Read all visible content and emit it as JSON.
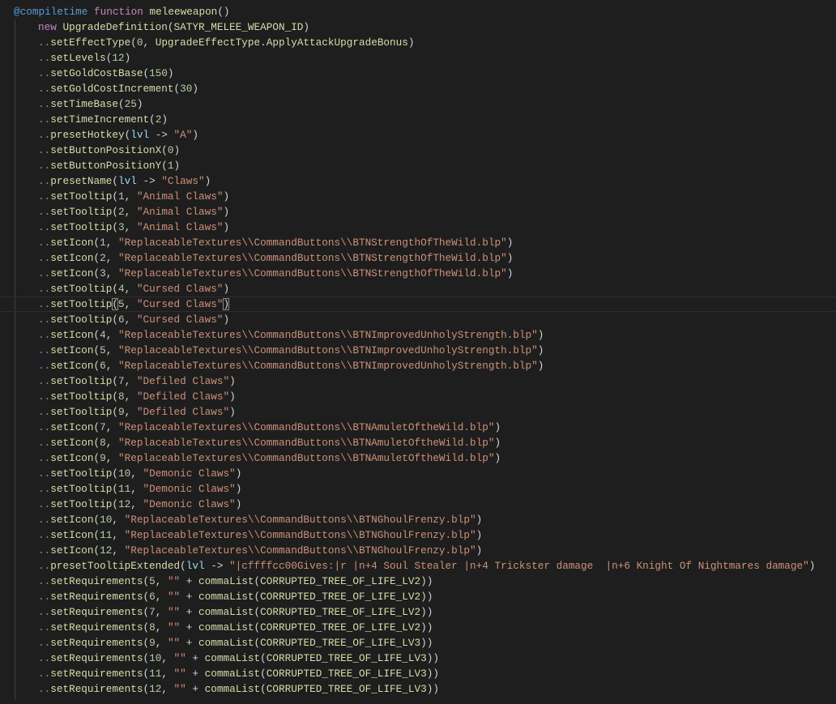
{
  "code": {
    "lines": [
      [
        [
          "k",
          "@compiletime"
        ],
        [
          "p",
          " "
        ],
        [
          "c",
          "function"
        ],
        [
          "p",
          " "
        ],
        [
          "f",
          "meleeweapon"
        ],
        [
          "p",
          "()"
        ]
      ],
      [
        [
          "c",
          "new"
        ],
        [
          "p",
          " "
        ],
        [
          "f",
          "UpgradeDefinition"
        ],
        [
          "p",
          "("
        ],
        [
          "f",
          "SATYR_MELEE_WEAPON_ID"
        ],
        [
          "p",
          ")"
        ]
      ],
      [
        [
          "d",
          ".."
        ],
        [
          "f",
          "setEffectType"
        ],
        [
          "p",
          "("
        ],
        [
          "n",
          "0"
        ],
        [
          "p",
          ", "
        ],
        [
          "f",
          "UpgradeEffectType"
        ],
        [
          "p",
          "."
        ],
        [
          "f",
          "ApplyAttackUpgradeBonus"
        ],
        [
          "p",
          ")"
        ]
      ],
      [
        [
          "d",
          ".."
        ],
        [
          "f",
          "setLevels"
        ],
        [
          "p",
          "("
        ],
        [
          "n",
          "12"
        ],
        [
          "p",
          ")"
        ]
      ],
      [
        [
          "d",
          ".."
        ],
        [
          "f",
          "setGoldCostBase"
        ],
        [
          "p",
          "("
        ],
        [
          "n",
          "150"
        ],
        [
          "p",
          ")"
        ]
      ],
      [
        [
          "d",
          ".."
        ],
        [
          "f",
          "setGoldCostIncrement"
        ],
        [
          "p",
          "("
        ],
        [
          "n",
          "30"
        ],
        [
          "p",
          ")"
        ]
      ],
      [
        [
          "d",
          ".."
        ],
        [
          "f",
          "setTimeBase"
        ],
        [
          "p",
          "("
        ],
        [
          "n",
          "25"
        ],
        [
          "p",
          ")"
        ]
      ],
      [
        [
          "d",
          ".."
        ],
        [
          "f",
          "setTimeIncrement"
        ],
        [
          "p",
          "("
        ],
        [
          "n",
          "2"
        ],
        [
          "p",
          ")"
        ]
      ],
      [
        [
          "d",
          ".."
        ],
        [
          "f",
          "presetHotkey"
        ],
        [
          "p",
          "("
        ],
        [
          "v",
          "lvl"
        ],
        [
          "p",
          " -> "
        ],
        [
          "s",
          "\"A\""
        ],
        [
          "p",
          ")"
        ]
      ],
      [
        [
          "d",
          ".."
        ],
        [
          "f",
          "setButtonPositionX"
        ],
        [
          "p",
          "("
        ],
        [
          "n",
          "0"
        ],
        [
          "p",
          ")"
        ]
      ],
      [
        [
          "d",
          ".."
        ],
        [
          "f",
          "setButtonPositionY"
        ],
        [
          "p",
          "("
        ],
        [
          "n",
          "1"
        ],
        [
          "p",
          ")"
        ]
      ],
      [
        [
          "d",
          ".."
        ],
        [
          "f",
          "presetName"
        ],
        [
          "p",
          "("
        ],
        [
          "v",
          "lvl"
        ],
        [
          "p",
          " -> "
        ],
        [
          "s",
          "\"Claws\""
        ],
        [
          "p",
          ")"
        ]
      ],
      [
        [
          "d",
          ".."
        ],
        [
          "f",
          "setTooltip"
        ],
        [
          "p",
          "("
        ],
        [
          "n",
          "1"
        ],
        [
          "p",
          ", "
        ],
        [
          "s",
          "\"Animal Claws\""
        ],
        [
          "p",
          ")"
        ]
      ],
      [
        [
          "d",
          ".."
        ],
        [
          "f",
          "setTooltip"
        ],
        [
          "p",
          "("
        ],
        [
          "n",
          "2"
        ],
        [
          "p",
          ", "
        ],
        [
          "s",
          "\"Animal Claws\""
        ],
        [
          "p",
          ")"
        ]
      ],
      [
        [
          "d",
          ".."
        ],
        [
          "f",
          "setTooltip"
        ],
        [
          "p",
          "("
        ],
        [
          "n",
          "3"
        ],
        [
          "p",
          ", "
        ],
        [
          "s",
          "\"Animal Claws\""
        ],
        [
          "p",
          ")"
        ]
      ],
      [
        [
          "d",
          ".."
        ],
        [
          "f",
          "setIcon"
        ],
        [
          "p",
          "("
        ],
        [
          "n",
          "1"
        ],
        [
          "p",
          ", "
        ],
        [
          "s",
          "\"ReplaceableTextures\\\\CommandButtons\\\\BTNStrengthOfTheWild.blp\""
        ],
        [
          "p",
          ")"
        ]
      ],
      [
        [
          "d",
          ".."
        ],
        [
          "f",
          "setIcon"
        ],
        [
          "p",
          "("
        ],
        [
          "n",
          "2"
        ],
        [
          "p",
          ", "
        ],
        [
          "s",
          "\"ReplaceableTextures\\\\CommandButtons\\\\BTNStrengthOfTheWild.blp\""
        ],
        [
          "p",
          ")"
        ]
      ],
      [
        [
          "d",
          ".."
        ],
        [
          "f",
          "setIcon"
        ],
        [
          "p",
          "("
        ],
        [
          "n",
          "3"
        ],
        [
          "p",
          ", "
        ],
        [
          "s",
          "\"ReplaceableTextures\\\\CommandButtons\\\\BTNStrengthOfTheWild.blp\""
        ],
        [
          "p",
          ")"
        ]
      ],
      [
        [
          "d",
          ".."
        ],
        [
          "f",
          "setTooltip"
        ],
        [
          "p",
          "("
        ],
        [
          "n",
          "4"
        ],
        [
          "p",
          ", "
        ],
        [
          "s",
          "\"Cursed Claws\""
        ],
        [
          "p",
          ")"
        ]
      ],
      [
        [
          "d",
          ".."
        ],
        [
          "f",
          "setTooltip"
        ],
        [
          "pb",
          "("
        ],
        [
          "n",
          "5"
        ],
        [
          "p",
          ", "
        ],
        [
          "s",
          "\"Cursed Claws\""
        ],
        [
          "pb",
          ")"
        ]
      ],
      [
        [
          "d",
          ".."
        ],
        [
          "f",
          "setTooltip"
        ],
        [
          "p",
          "("
        ],
        [
          "n",
          "6"
        ],
        [
          "p",
          ", "
        ],
        [
          "s",
          "\"Cursed Claws\""
        ],
        [
          "p",
          ")"
        ]
      ],
      [
        [
          "d",
          ".."
        ],
        [
          "f",
          "setIcon"
        ],
        [
          "p",
          "("
        ],
        [
          "n",
          "4"
        ],
        [
          "p",
          ", "
        ],
        [
          "s",
          "\"ReplaceableTextures\\\\CommandButtons\\\\BTNImprovedUnholyStrength.blp\""
        ],
        [
          "p",
          ")"
        ]
      ],
      [
        [
          "d",
          ".."
        ],
        [
          "f",
          "setIcon"
        ],
        [
          "p",
          "("
        ],
        [
          "n",
          "5"
        ],
        [
          "p",
          ", "
        ],
        [
          "s",
          "\"ReplaceableTextures\\\\CommandButtons\\\\BTNImprovedUnholyStrength.blp\""
        ],
        [
          "p",
          ")"
        ]
      ],
      [
        [
          "d",
          ".."
        ],
        [
          "f",
          "setIcon"
        ],
        [
          "p",
          "("
        ],
        [
          "n",
          "6"
        ],
        [
          "p",
          ", "
        ],
        [
          "s",
          "\"ReplaceableTextures\\\\CommandButtons\\\\BTNImprovedUnholyStrength.blp\""
        ],
        [
          "p",
          ")"
        ]
      ],
      [
        [
          "d",
          ".."
        ],
        [
          "f",
          "setTooltip"
        ],
        [
          "p",
          "("
        ],
        [
          "n",
          "7"
        ],
        [
          "p",
          ", "
        ],
        [
          "s",
          "\"Defiled Claws\""
        ],
        [
          "p",
          ")"
        ]
      ],
      [
        [
          "d",
          ".."
        ],
        [
          "f",
          "setTooltip"
        ],
        [
          "p",
          "("
        ],
        [
          "n",
          "8"
        ],
        [
          "p",
          ", "
        ],
        [
          "s",
          "\"Defiled Claws\""
        ],
        [
          "p",
          ")"
        ]
      ],
      [
        [
          "d",
          ".."
        ],
        [
          "f",
          "setTooltip"
        ],
        [
          "p",
          "("
        ],
        [
          "n",
          "9"
        ],
        [
          "p",
          ", "
        ],
        [
          "s",
          "\"Defiled Claws\""
        ],
        [
          "p",
          ")"
        ]
      ],
      [
        [
          "d",
          ".."
        ],
        [
          "f",
          "setIcon"
        ],
        [
          "p",
          "("
        ],
        [
          "n",
          "7"
        ],
        [
          "p",
          ", "
        ],
        [
          "s",
          "\"ReplaceableTextures\\\\CommandButtons\\\\BTNAmuletOftheWild.blp\""
        ],
        [
          "p",
          ")"
        ]
      ],
      [
        [
          "d",
          ".."
        ],
        [
          "f",
          "setIcon"
        ],
        [
          "p",
          "("
        ],
        [
          "n",
          "8"
        ],
        [
          "p",
          ", "
        ],
        [
          "s",
          "\"ReplaceableTextures\\\\CommandButtons\\\\BTNAmuletOftheWild.blp\""
        ],
        [
          "p",
          ")"
        ]
      ],
      [
        [
          "d",
          ".."
        ],
        [
          "f",
          "setIcon"
        ],
        [
          "p",
          "("
        ],
        [
          "n",
          "9"
        ],
        [
          "p",
          ", "
        ],
        [
          "s",
          "\"ReplaceableTextures\\\\CommandButtons\\\\BTNAmuletOftheWild.blp\""
        ],
        [
          "p",
          ")"
        ]
      ],
      [
        [
          "d",
          ".."
        ],
        [
          "f",
          "setTooltip"
        ],
        [
          "p",
          "("
        ],
        [
          "n",
          "10"
        ],
        [
          "p",
          ", "
        ],
        [
          "s",
          "\"Demonic Claws\""
        ],
        [
          "p",
          ")"
        ]
      ],
      [
        [
          "d",
          ".."
        ],
        [
          "f",
          "setTooltip"
        ],
        [
          "p",
          "("
        ],
        [
          "n",
          "11"
        ],
        [
          "p",
          ", "
        ],
        [
          "s",
          "\"Demonic Claws\""
        ],
        [
          "p",
          ")"
        ]
      ],
      [
        [
          "d",
          ".."
        ],
        [
          "f",
          "setTooltip"
        ],
        [
          "p",
          "("
        ],
        [
          "n",
          "12"
        ],
        [
          "p",
          ", "
        ],
        [
          "s",
          "\"Demonic Claws\""
        ],
        [
          "p",
          ")"
        ]
      ],
      [
        [
          "d",
          ".."
        ],
        [
          "f",
          "setIcon"
        ],
        [
          "p",
          "("
        ],
        [
          "n",
          "10"
        ],
        [
          "p",
          ", "
        ],
        [
          "s",
          "\"ReplaceableTextures\\\\CommandButtons\\\\BTNGhoulFrenzy.blp\""
        ],
        [
          "p",
          ")"
        ]
      ],
      [
        [
          "d",
          ".."
        ],
        [
          "f",
          "setIcon"
        ],
        [
          "p",
          "("
        ],
        [
          "n",
          "11"
        ],
        [
          "p",
          ", "
        ],
        [
          "s",
          "\"ReplaceableTextures\\\\CommandButtons\\\\BTNGhoulFrenzy.blp\""
        ],
        [
          "p",
          ")"
        ]
      ],
      [
        [
          "d",
          ".."
        ],
        [
          "f",
          "setIcon"
        ],
        [
          "p",
          "("
        ],
        [
          "n",
          "12"
        ],
        [
          "p",
          ", "
        ],
        [
          "s",
          "\"ReplaceableTextures\\\\CommandButtons\\\\BTNGhoulFrenzy.blp\""
        ],
        [
          "p",
          ")"
        ]
      ],
      [
        [
          "d",
          ".."
        ],
        [
          "f",
          "presetTooltipExtended"
        ],
        [
          "p",
          "("
        ],
        [
          "v",
          "lvl"
        ],
        [
          "p",
          " -> "
        ],
        [
          "s",
          "\"|cffffcc00Gives:|r |n+4 Soul Stealer |n+4 Trickster damage  |n+6 Knight Of Nightmares damage\""
        ],
        [
          "p",
          ")"
        ]
      ],
      [
        [
          "d",
          ".."
        ],
        [
          "f",
          "setRequirements"
        ],
        [
          "p",
          "("
        ],
        [
          "n",
          "5"
        ],
        [
          "p",
          ", "
        ],
        [
          "s",
          "\"\""
        ],
        [
          "p",
          " + "
        ],
        [
          "f",
          "commaList"
        ],
        [
          "p",
          "("
        ],
        [
          "f",
          "CORRUPTED_TREE_OF_LIFE_LV2"
        ],
        [
          "p",
          "))"
        ]
      ],
      [
        [
          "d",
          ".."
        ],
        [
          "f",
          "setRequirements"
        ],
        [
          "p",
          "("
        ],
        [
          "n",
          "6"
        ],
        [
          "p",
          ", "
        ],
        [
          "s",
          "\"\""
        ],
        [
          "p",
          " + "
        ],
        [
          "f",
          "commaList"
        ],
        [
          "p",
          "("
        ],
        [
          "f",
          "CORRUPTED_TREE_OF_LIFE_LV2"
        ],
        [
          "p",
          "))"
        ]
      ],
      [
        [
          "d",
          ".."
        ],
        [
          "f",
          "setRequirements"
        ],
        [
          "p",
          "("
        ],
        [
          "n",
          "7"
        ],
        [
          "p",
          ", "
        ],
        [
          "s",
          "\"\""
        ],
        [
          "p",
          " + "
        ],
        [
          "f",
          "commaList"
        ],
        [
          "p",
          "("
        ],
        [
          "f",
          "CORRUPTED_TREE_OF_LIFE_LV2"
        ],
        [
          "p",
          "))"
        ]
      ],
      [
        [
          "d",
          ".."
        ],
        [
          "f",
          "setRequirements"
        ],
        [
          "p",
          "("
        ],
        [
          "n",
          "8"
        ],
        [
          "p",
          ", "
        ],
        [
          "s",
          "\"\""
        ],
        [
          "p",
          " + "
        ],
        [
          "f",
          "commaList"
        ],
        [
          "p",
          "("
        ],
        [
          "f",
          "CORRUPTED_TREE_OF_LIFE_LV2"
        ],
        [
          "p",
          "))"
        ]
      ],
      [
        [
          "d",
          ".."
        ],
        [
          "f",
          "setRequirements"
        ],
        [
          "p",
          "("
        ],
        [
          "n",
          "9"
        ],
        [
          "p",
          ", "
        ],
        [
          "s",
          "\"\""
        ],
        [
          "p",
          " + "
        ],
        [
          "f",
          "commaList"
        ],
        [
          "p",
          "("
        ],
        [
          "f",
          "CORRUPTED_TREE_OF_LIFE_LV3"
        ],
        [
          "p",
          "))"
        ]
      ],
      [
        [
          "d",
          ".."
        ],
        [
          "f",
          "setRequirements"
        ],
        [
          "p",
          "("
        ],
        [
          "n",
          "10"
        ],
        [
          "p",
          ", "
        ],
        [
          "s",
          "\"\""
        ],
        [
          "p",
          " + "
        ],
        [
          "f",
          "commaList"
        ],
        [
          "p",
          "("
        ],
        [
          "f",
          "CORRUPTED_TREE_OF_LIFE_LV3"
        ],
        [
          "p",
          "))"
        ]
      ],
      [
        [
          "d",
          ".."
        ],
        [
          "f",
          "setRequirements"
        ],
        [
          "p",
          "("
        ],
        [
          "n",
          "11"
        ],
        [
          "p",
          ", "
        ],
        [
          "s",
          "\"\""
        ],
        [
          "p",
          " + "
        ],
        [
          "f",
          "commaList"
        ],
        [
          "p",
          "("
        ],
        [
          "f",
          "CORRUPTED_TREE_OF_LIFE_LV3"
        ],
        [
          "p",
          "))"
        ]
      ],
      [
        [
          "d",
          ".."
        ],
        [
          "f",
          "setRequirements"
        ],
        [
          "p",
          "("
        ],
        [
          "n",
          "12"
        ],
        [
          "p",
          ", "
        ],
        [
          "s",
          "\"\""
        ],
        [
          "p",
          " + "
        ],
        [
          "f",
          "commaList"
        ],
        [
          "p",
          "("
        ],
        [
          "f",
          "CORRUPTED_TREE_OF_LIFE_LV3"
        ],
        [
          "p",
          "))"
        ]
      ]
    ],
    "current_line": 19
  }
}
